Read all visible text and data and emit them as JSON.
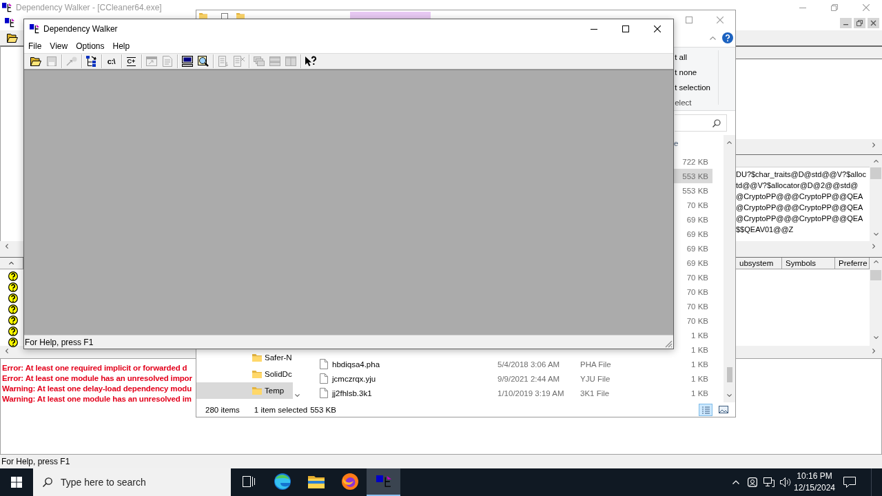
{
  "main_window": {
    "title": "Dependency Walker - [CCleaner64.exe]",
    "active": false,
    "export_lines": [
      "DU?$char_traits@D@std@@V?$alloc",
      "td@@V?$allocator@D@2@@std@",
      "@CryptoPP@@@CryptoPP@@QEA",
      "@CryptoPP@@@CryptoPP@@QEA",
      "@CryptoPP@@@CryptoPP@@QEA",
      "$$QEAV01@@Z"
    ],
    "module_columns": [
      "ubsystem",
      "Symbols",
      "Preferre"
    ],
    "modules": [
      {
        "kind": "missing"
      },
      {
        "kind": "missing"
      },
      {
        "kind": "missing"
      },
      {
        "kind": "missing"
      },
      {
        "kind": "missing"
      },
      {
        "kind": "missing"
      },
      {
        "kind": "missing"
      }
    ],
    "log": [
      "Error: At least one required implicit or forwarded d",
      "Error: At least one module has an unresolved impor",
      "Warning: At least one delay-load dependency modu",
      "Warning: At least one module has an unresolved im"
    ],
    "status_bar": "For Help, press F1"
  },
  "explorer": {
    "active": false,
    "select_commands": [
      "t all",
      "t none",
      "t selection"
    ],
    "select_group": "elect",
    "columns": [
      "e"
    ],
    "files": [
      {
        "size": "722 KB",
        "selected": false
      },
      {
        "size": "553 KB",
        "selected": true
      },
      {
        "size": "553 KB",
        "selected": false
      },
      {
        "size": "70 KB",
        "selected": false
      },
      {
        "size": "69 KB",
        "selected": false
      },
      {
        "size": "69 KB",
        "selected": false
      },
      {
        "size": "69 KB",
        "selected": false
      },
      {
        "size": "69 KB",
        "selected": false
      },
      {
        "size": "70 KB",
        "selected": false
      },
      {
        "size": "70 KB",
        "selected": false
      },
      {
        "size": "70 KB",
        "selected": false
      },
      {
        "size": "70 KB",
        "selected": false
      },
      {
        "size": "1 KB",
        "selected": false
      },
      {
        "size": "1 KB",
        "selected": false
      },
      {
        "name": "hbdiqsa4.pha",
        "date": "5/4/2018 3:06 AM",
        "type": "PHA File",
        "size": "1 KB",
        "selected": false
      },
      {
        "name": "jcmczrqx.yju",
        "date": "9/9/2021 2:44 AM",
        "type": "YJU File",
        "size": "1 KB",
        "selected": false
      },
      {
        "name": "jj2fhlsb.3k1",
        "date": "1/10/2019 3:19 AM",
        "type": "3K1 File",
        "size": "1 KB",
        "selected": false
      }
    ],
    "nav_items": [
      {
        "label": "Safer-N",
        "selected": false
      },
      {
        "label": "SolidDc",
        "selected": false
      },
      {
        "label": "Temp",
        "selected": true
      }
    ],
    "status": {
      "items": "280 items",
      "selection": "1 item selected",
      "size": "553 KB"
    },
    "views": [
      {
        "kind": "details",
        "selected": true
      },
      {
        "kind": "thumbnails",
        "selected": false
      }
    ]
  },
  "dialog": {
    "title": "Dependency Walker",
    "active": true,
    "menu": [
      "File",
      "View",
      "Options",
      "Help"
    ],
    "toolbar": [
      {
        "kind": "open",
        "disabled": false
      },
      {
        "kind": "save",
        "disabled": true
      },
      {
        "kind": "separator"
      },
      {
        "kind": "pin",
        "disabled": true
      },
      {
        "kind": "separator"
      },
      {
        "kind": "tree",
        "disabled": false
      },
      {
        "kind": "separator"
      },
      {
        "kind": "path",
        "label": "c:\\",
        "disabled": false
      },
      {
        "kind": "separator"
      },
      {
        "kind": "code",
        "label": "C+",
        "disabled": false
      },
      {
        "kind": "separator"
      },
      {
        "kind": "window",
        "disabled": true
      },
      {
        "kind": "props",
        "disabled": true
      },
      {
        "kind": "separator"
      },
      {
        "kind": "computer",
        "disabled": false
      },
      {
        "kind": "find",
        "disabled": false
      },
      {
        "kind": "separator"
      },
      {
        "kind": "list",
        "disabled": true
      },
      {
        "kind": "remove",
        "disabled": true
      },
      {
        "kind": "separator"
      },
      {
        "kind": "cascade",
        "disabled": true
      },
      {
        "kind": "rows",
        "disabled": true
      },
      {
        "kind": "columns",
        "disabled": true
      },
      {
        "kind": "separator"
      },
      {
        "kind": "help",
        "disabled": false
      }
    ],
    "status_bar": "For Help, press F1"
  },
  "taskbar": {
    "search": {
      "placeholder": "Type here to search"
    },
    "apps": [
      {
        "kind": "taskview",
        "selected": false
      },
      {
        "kind": "edge",
        "selected": false
      },
      {
        "kind": "explorer",
        "selected": false
      },
      {
        "kind": "firefox",
        "selected": false
      },
      {
        "kind": "walker",
        "selected": true
      }
    ],
    "time": "10:16 PM",
    "date": "12/15/2024"
  }
}
